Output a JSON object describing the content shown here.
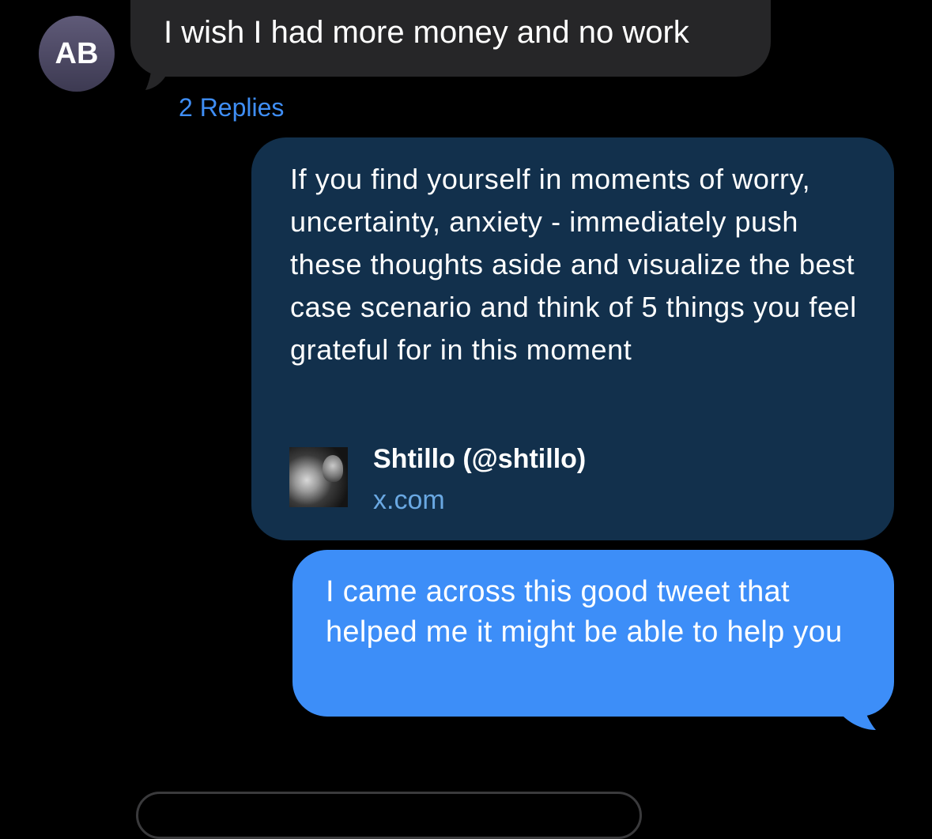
{
  "incoming_message": {
    "avatar_initials": "AB",
    "text": "I wish I had more money and no work",
    "replies_label": "2 Replies"
  },
  "link_preview": {
    "text": "If you find yourself in moments of worry, uncertainty, anxiety - immediately push these thoughts aside and visualize the best case scenario and think of 5 things you feel grateful for in this moment",
    "source_name": "Shtillo (@shtillo)",
    "source_domain": "x.com"
  },
  "outgoing_message": {
    "text": "I came across this good tweet that helped me it might be able to help you"
  },
  "colors": {
    "background": "#000000",
    "incoming_bubble": "#262628",
    "link_card": "#12304c",
    "outgoing_bubble": "#3d8ef8",
    "accent_link": "#3f8ef5"
  }
}
